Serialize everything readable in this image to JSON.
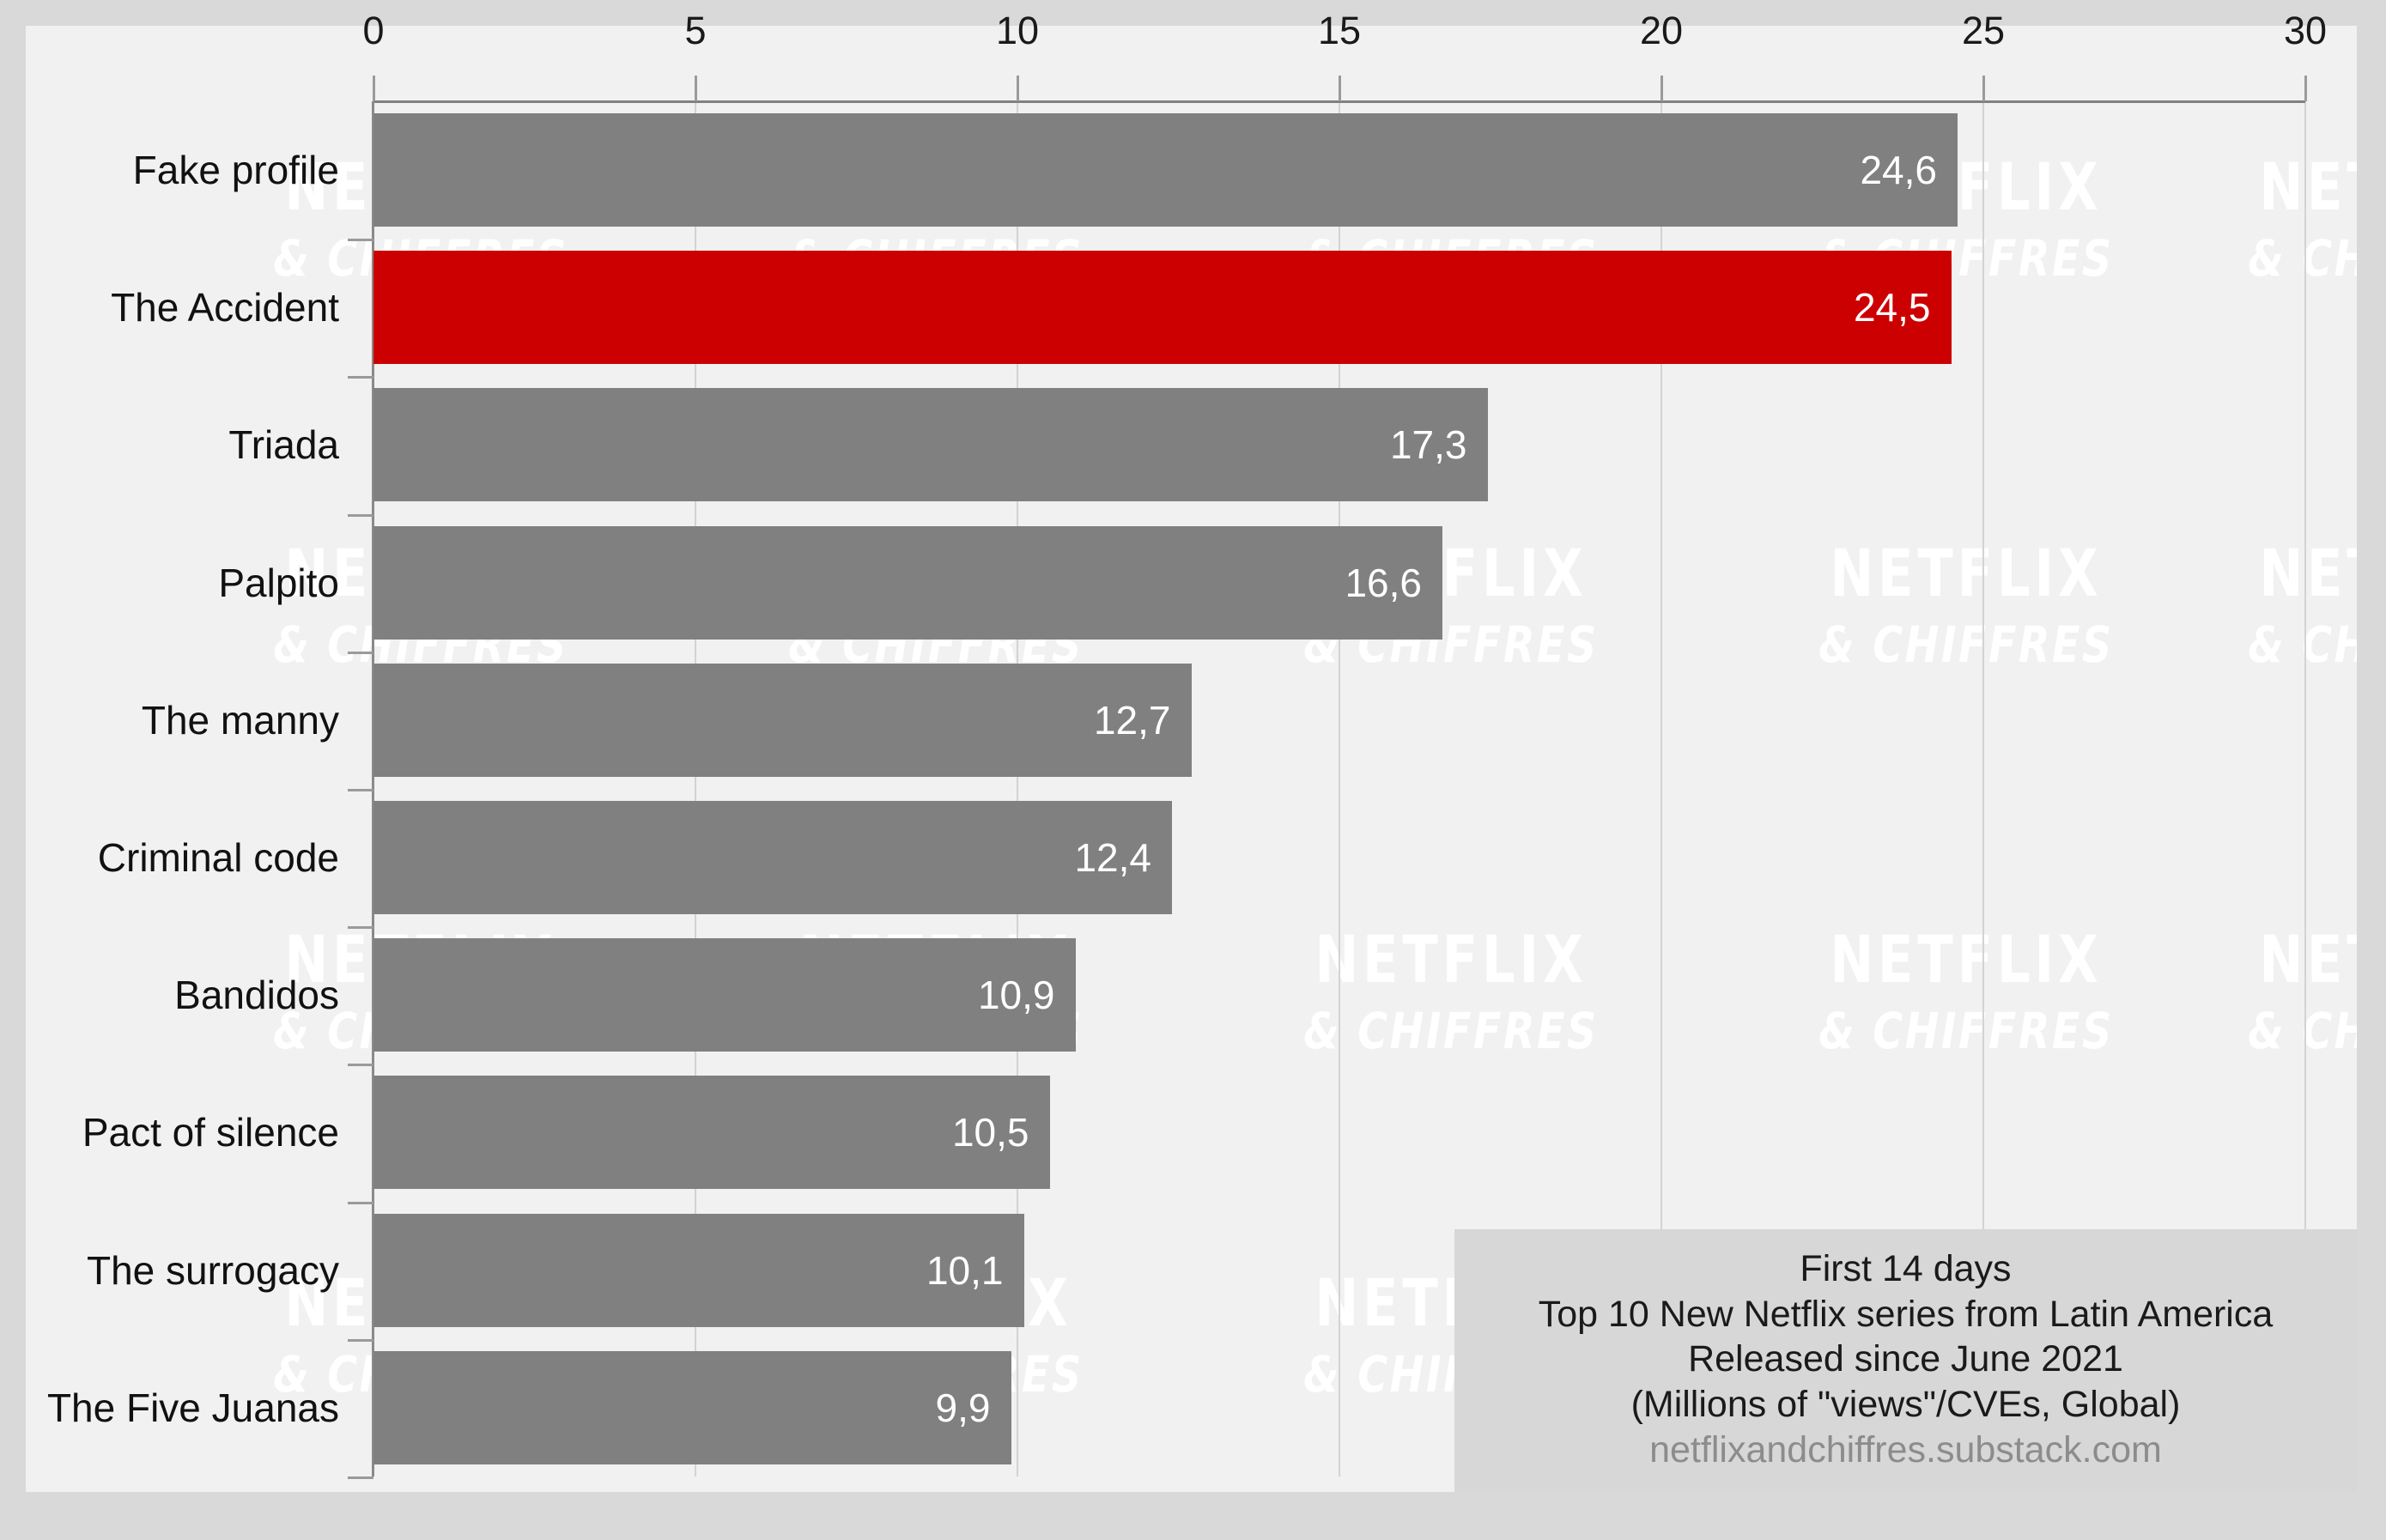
{
  "chart_data": {
    "type": "bar",
    "orientation": "horizontal",
    "title": "",
    "xlabel": "",
    "ylabel": "",
    "xlim": [
      0,
      30
    ],
    "xticks": [
      "0",
      "5",
      "10",
      "15",
      "20",
      "25",
      "30"
    ],
    "grid": true,
    "legend": "none",
    "decimal_separator": ",",
    "categories": [
      "Fake profile",
      "The Accident",
      "Triada",
      "Palpito",
      "The manny",
      "Criminal code",
      "Bandidos",
      "Pact of silence",
      "The surrogacy",
      "The Five Juanas"
    ],
    "values": [
      24.6,
      24.5,
      17.3,
      16.6,
      12.7,
      12.4,
      10.9,
      10.5,
      10.1,
      9.9
    ],
    "value_labels": [
      "24,6",
      "24,5",
      "17,3",
      "16,6",
      "12,7",
      "12,4",
      "10,9",
      "10,5",
      "10,1",
      "9,9"
    ],
    "highlight_index": 1,
    "colors": {
      "bar": "#808080",
      "highlight_bar": "#cc0000",
      "bar_label_text": "#ffffff",
      "panel_background": "#f1f1f1",
      "outer_background": "#d9d9d9",
      "gridline": "#d3d3d3",
      "axis": "#8a8a8a",
      "tick_text": "#1a1a1a",
      "caption_background": "#d7d7d7",
      "caption_text": "#1a1a1a",
      "caption_url_text": "#8c8c8c",
      "watermark": "#ffffff"
    }
  },
  "caption": {
    "line1": "First 14 days",
    "line2": "Top 10 New Netflix series from Latin America",
    "line3": "Released since June 2021",
    "line4": "(Millions of \"views\"/CVEs, Global)",
    "url": "netflixandchiffres.substack.com"
  },
  "watermark": {
    "line1": "NETFLIX",
    "line2": "& CHIFFRES"
  }
}
